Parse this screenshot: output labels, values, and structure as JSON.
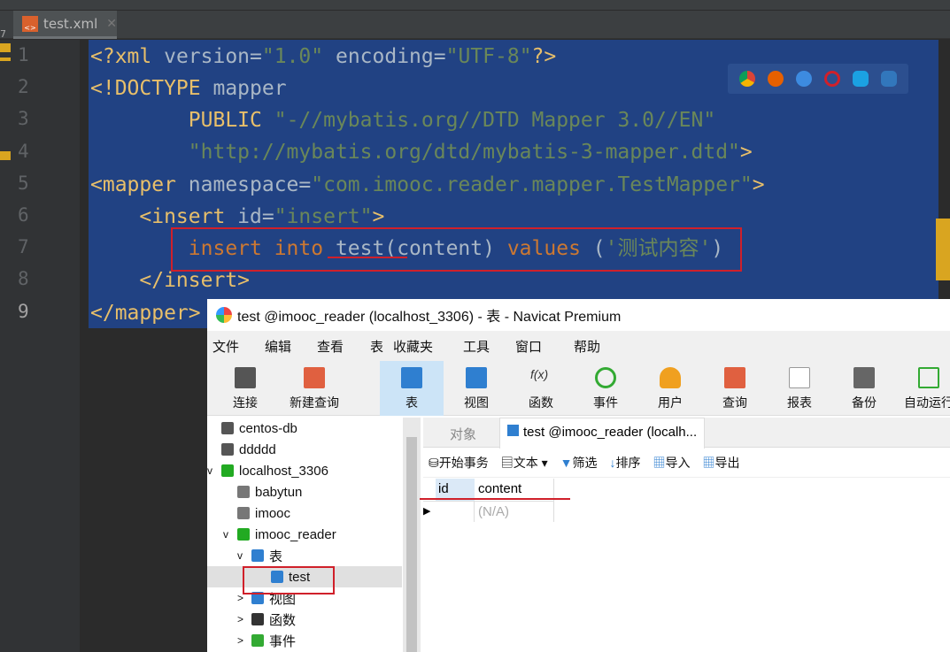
{
  "editor": {
    "tab": "test.xml",
    "side_number": "7",
    "line_numbers": [
      "1",
      "2",
      "3",
      "4",
      "5",
      "6",
      "7",
      "8",
      "9"
    ],
    "colors": {
      "selection": "#214283",
      "highlight": "#d0202a"
    },
    "browser_icons": [
      "chrome-icon",
      "firefox-icon",
      "safari-icon",
      "opera-icon",
      "ie-icon",
      "edge-icon"
    ]
  },
  "code": {
    "l1a": "<?xml ",
    "l1b": "version=",
    "l1c": "\"1.0\"",
    "l1d": " encoding=",
    "l1e": "\"UTF-8\"",
    "l1f": "?>",
    "l2a": "<!DOCTYPE ",
    "l2b": "mapper",
    "l3a": "        PUBLIC ",
    "l3b": "\"-//mybatis.org//DTD Mapper 3.0//EN\"",
    "l4": "        \"http://mybatis.org/dtd/mybatis-3-mapper.dtd\"",
    "l4b": ">",
    "l5a": "<mapper ",
    "l5b": "namespace=",
    "l5c": "\"com.imooc.reader.mapper.TestMapper\"",
    "l5d": ">",
    "l6a": "    <insert ",
    "l6b": "id=",
    "l6c": "\"insert\"",
    "l6d": ">",
    "l7a": "        insert into ",
    "l7b": "test(content) ",
    "l7c": "values ",
    "l7d": "(",
    "l7e": "'测试内容'",
    "l7f": ")",
    "l8": "    </insert>",
    "l9": "</mapper>"
  },
  "navicat": {
    "title": "test @imooc_reader (localhost_3306) - 表 - Navicat Premium",
    "menu": [
      "文件",
      "编辑",
      "查看",
      "表",
      "收藏夹",
      "工具",
      "窗口",
      "帮助"
    ],
    "toolbar": [
      "连接",
      "新建查询",
      "表",
      "视图",
      "函数",
      "事件",
      "用户",
      "查询",
      "报表",
      "备份",
      "自动运行"
    ],
    "tree": [
      "centos-db",
      "ddddd",
      "localhost_3306",
      "babytun",
      "imooc",
      "imooc_reader",
      "表",
      "test",
      "视图",
      "函数",
      "事件"
    ],
    "tabs": [
      "对象",
      "test @imooc_reader (localh..."
    ],
    "subtoolbar": [
      "开始事务",
      "文本",
      "筛选",
      "排序",
      "导入",
      "导出"
    ],
    "columns": [
      "id",
      "content"
    ],
    "row": [
      "",
      "(N/A)"
    ]
  }
}
